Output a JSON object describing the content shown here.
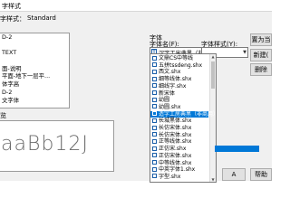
{
  "title": "字样式",
  "current_style_label": "字样式：",
  "current_style_value": "Standard",
  "styles_list": [
    "D-2",
    "",
    "TEXT",
    "",
    "面-说明",
    "平面-地下一层平...",
    "体字高",
    "D-2",
    "文字体"
  ],
  "preview_label": "览",
  "preview_text": "aaBb12J",
  "font_group_label": "字体",
  "font_name_label": "字体名(F):",
  "font_style_label": "字体样式(Y):",
  "font_name_selected": "汉字工宋典黑（非商用）",
  "dropdown_items": [
    "文鼎CS中等线",
    "五拼tssdeng.shx",
    "西文.shx",
    "细等线体.shx",
    "细线字.shx",
    "新宋体",
    "幼圆",
    "幼圆.shx",
    "造字工房典黑（非商用）粗体",
    "长城黑体.shx",
    "长仿宋体.shx",
    "长仿宋体.shx",
    "正等线体.shx",
    "正仿宋.shx",
    "正仿宋体.shx",
    "中等线体.shx",
    "中英字体1.shx",
    "字型.shx"
  ],
  "selected_index": 8,
  "buttons": {
    "set_current": "置为当",
    "new": "新建(",
    "delete": "删除",
    "apply": "A",
    "help": "帮助"
  }
}
